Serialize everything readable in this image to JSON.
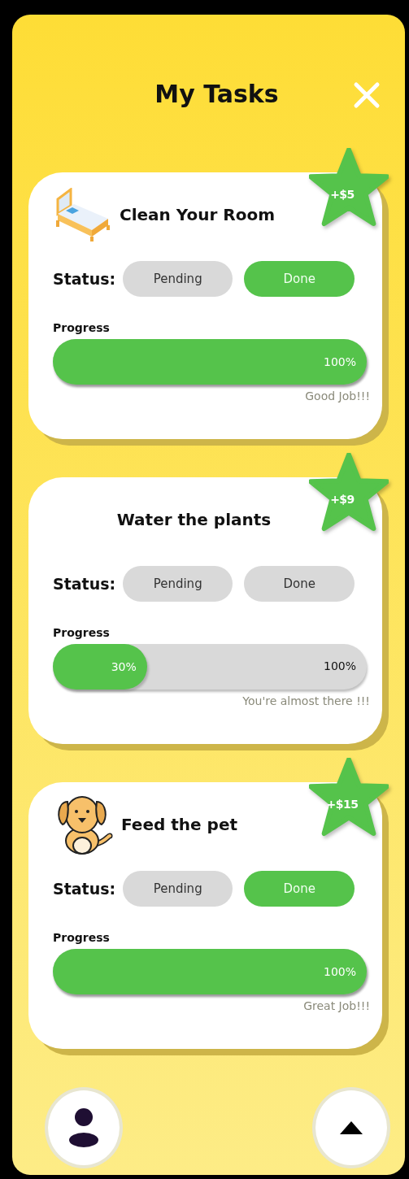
{
  "header": {
    "title": "My Tasks"
  },
  "tasks": [
    {
      "kind": "bed",
      "title": "Clean Your Room",
      "reward": "+$5",
      "status_label": "Status:",
      "statuses": [
        {
          "label": "Pending",
          "selected": false
        },
        {
          "label": "Done",
          "selected": true
        }
      ],
      "progress_label": "Progress",
      "progress": {
        "level": 1,
        "fill_label": "100%"
      },
      "message": "Good Job!!!"
    },
    {
      "kind": "plain",
      "title": "Water the plants",
      "reward": "+$9",
      "status_label": "Status:",
      "statuses": [
        {
          "label": "Pending",
          "selected": false
        },
        {
          "label": "Done",
          "selected": false
        }
      ],
      "progress_label": "Progress",
      "progress": {
        "level": 0.3,
        "fill_label": "30%",
        "end_label": "100%"
      },
      "message": "You're almost there !!!"
    },
    {
      "kind": "dog",
      "title": "Feed the pet",
      "reward": "+$15",
      "status_label": "Status:",
      "statuses": [
        {
          "label": "Pending",
          "selected": false
        },
        {
          "label": "Done",
          "selected": true
        }
      ],
      "progress_label": "Progress",
      "progress": {
        "level": 1,
        "fill_label": "100%"
      },
      "message": "Great Job!!!"
    }
  ]
}
